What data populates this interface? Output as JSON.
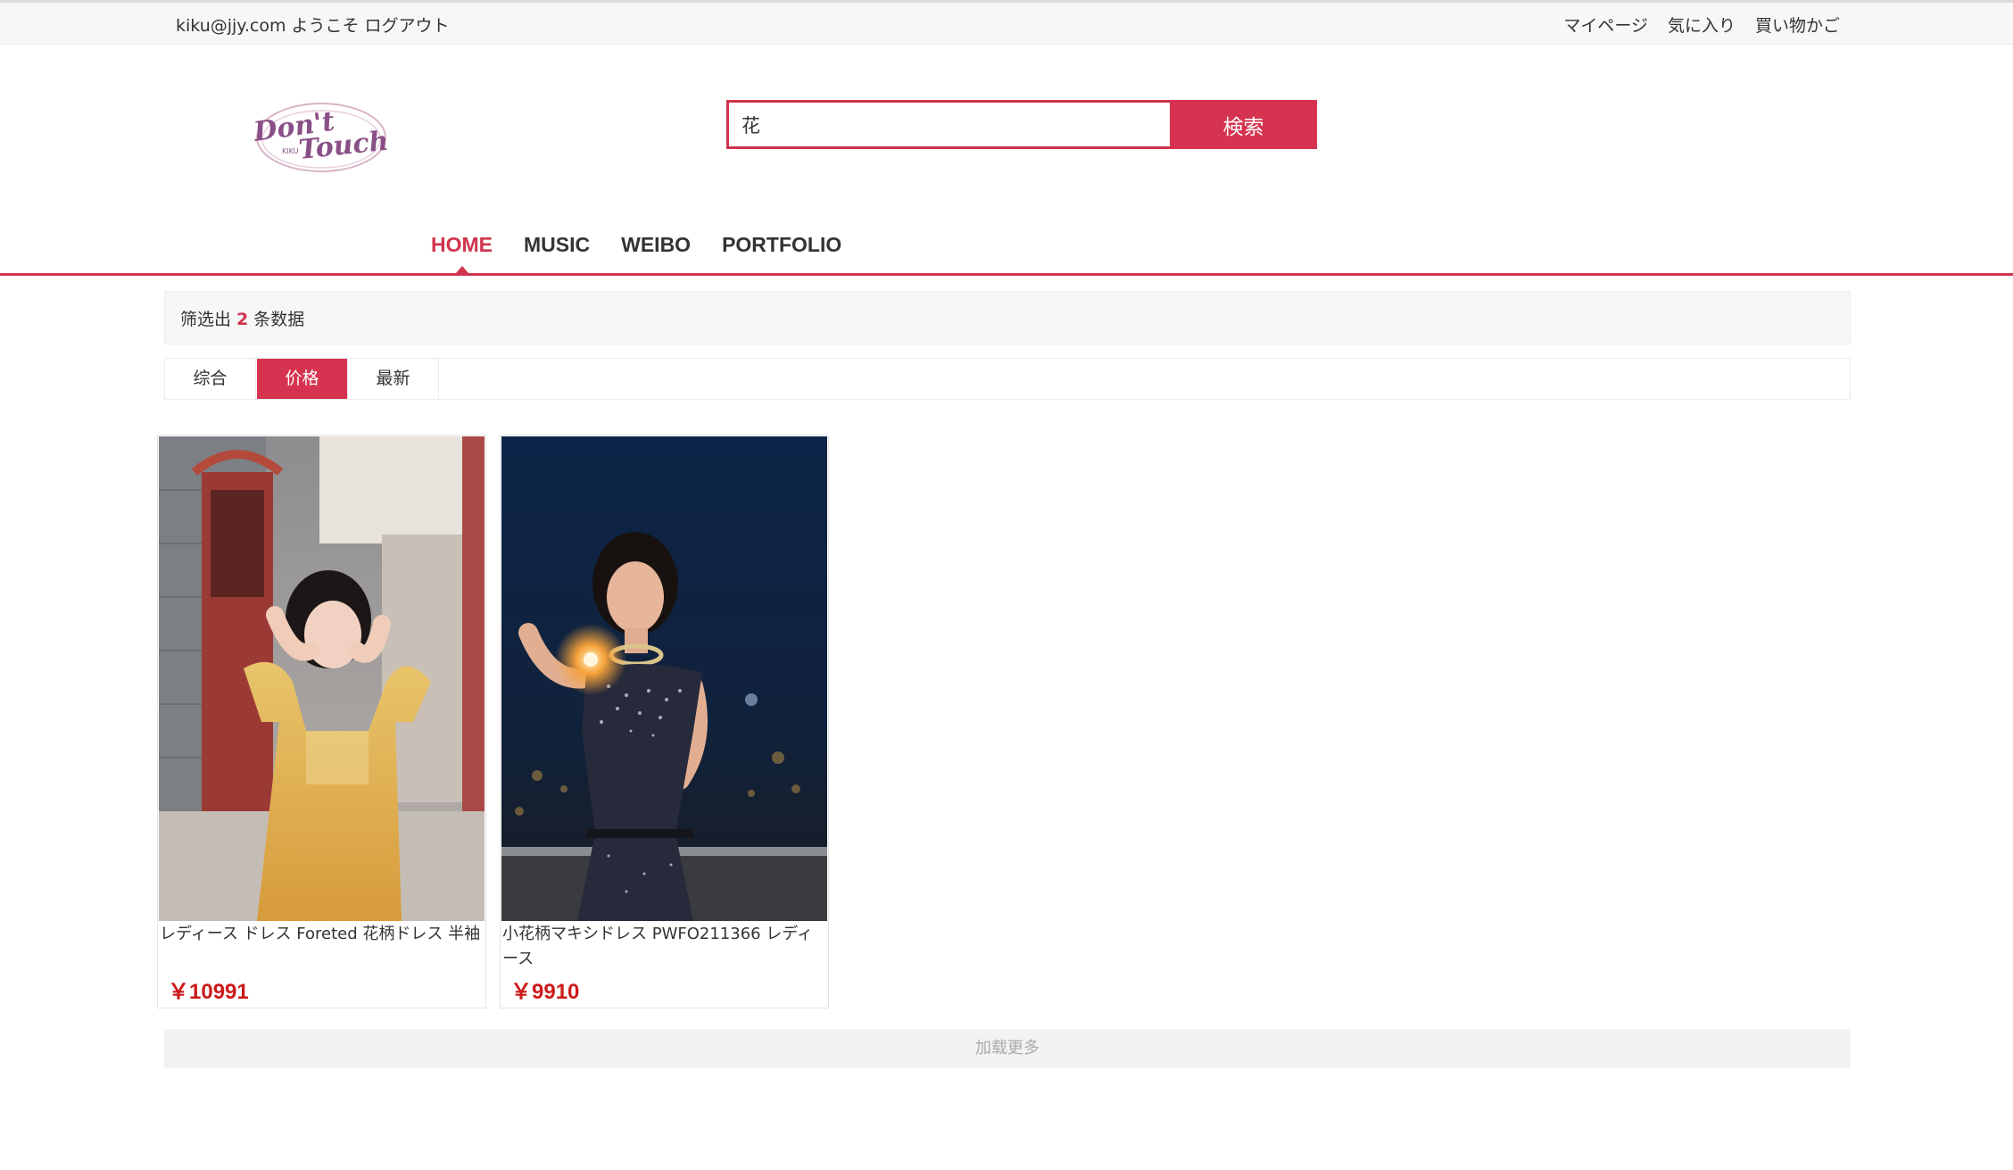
{
  "topbar": {
    "user_email": "kiku@jjy.com",
    "welcome": "ようこそ",
    "logout": "ログアウト",
    "links": [
      "マイページ",
      "気に入り",
      "買い物かご"
    ]
  },
  "logo": {
    "line1": "Don't",
    "line2": "Touch",
    "small": "KIKU"
  },
  "search": {
    "value": "花",
    "button": "検索"
  },
  "nav": [
    "HOME",
    "MUSIC",
    "WEIBO",
    "PORTFOLIO"
  ],
  "result": {
    "prefix": "筛选出",
    "count": "2",
    "suffix": "条数据"
  },
  "sort_tabs": [
    "综合",
    "价格",
    "最新"
  ],
  "active_sort": "价格",
  "products": [
    {
      "title": "レディース ドレス Foreted 花柄ドレス 半袖",
      "price": "￥10991"
    },
    {
      "title": "小花柄マキシドレス PWFO211366 レディース",
      "price": "￥9910"
    }
  ],
  "load_more": "加载更多",
  "colors": {
    "accent": "#d5334f",
    "price": "#cc1a1a"
  }
}
